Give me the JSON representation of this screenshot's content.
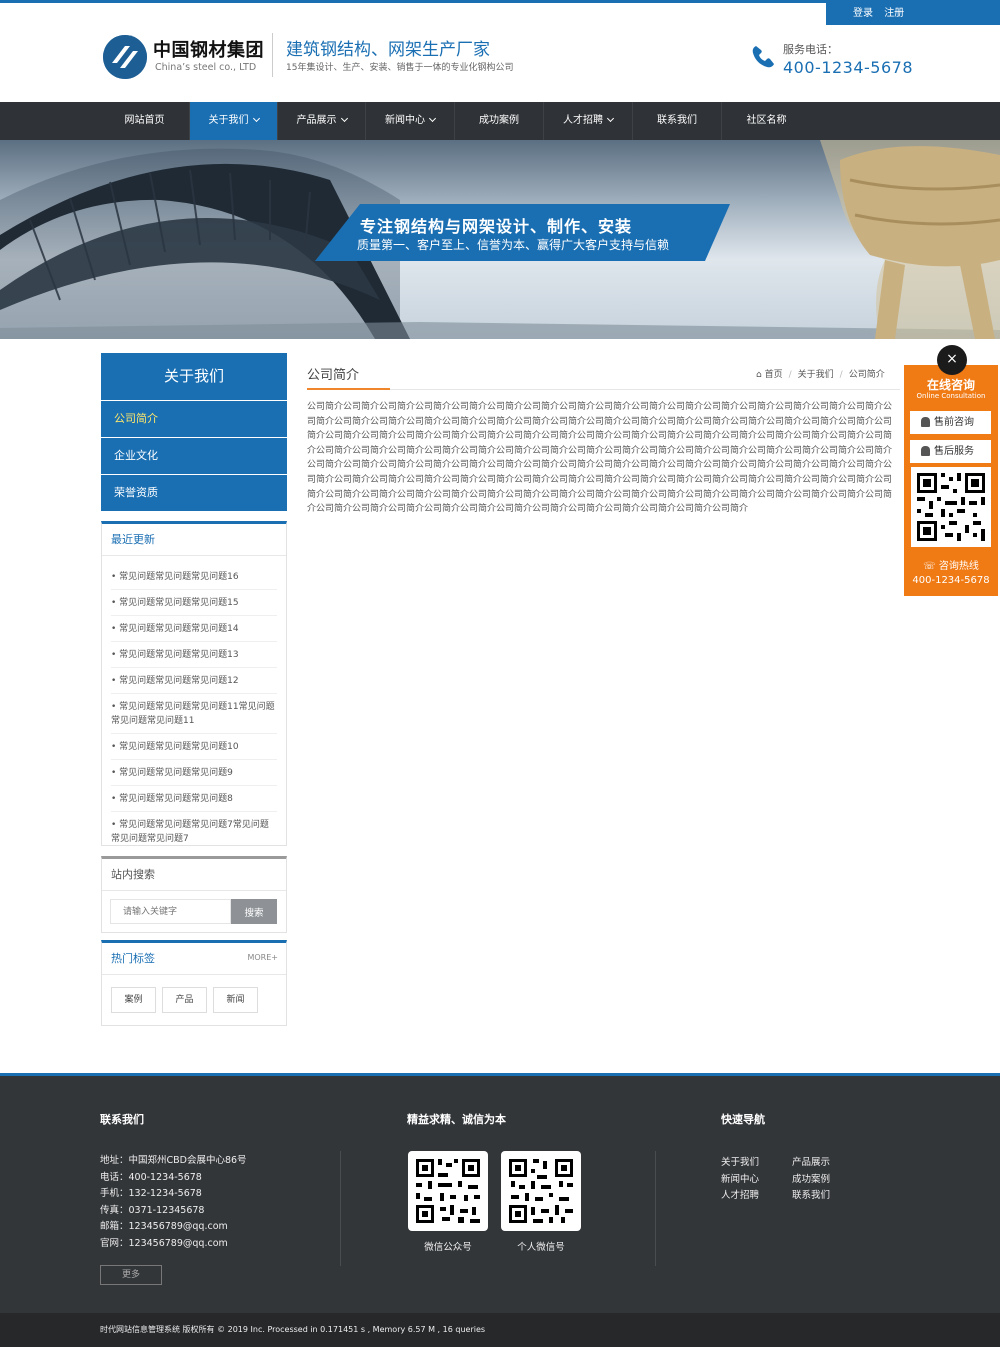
{
  "topbar": {
    "login": "登录",
    "register": "注册"
  },
  "header": {
    "logo_cn": "中国钢材集团",
    "logo_en": "China’s steel co., LTD",
    "slogan": "建筑钢结构、网架生产厂家",
    "slogan_sub": "15年集设计、生产、安装、销售于一体的专业化钢构公司",
    "service_label": "服务电话：",
    "service_number": "400-1234-5678"
  },
  "nav": {
    "items": [
      {
        "label": "网站首页"
      },
      {
        "label": "关于我们"
      },
      {
        "label": "产品展示"
      },
      {
        "label": "新闻中心"
      },
      {
        "label": "成功案例"
      },
      {
        "label": "人才招聘"
      },
      {
        "label": "联系我们"
      },
      {
        "label": "社区名称"
      }
    ]
  },
  "banner": {
    "title": "专注钢结构与网架设计、制作、安装",
    "subtitle": "质量第一、客户至上、信誉为本、赢得广大客户支持与信赖"
  },
  "sidebar": {
    "heading": "关于我们",
    "items": [
      {
        "label": "公司简介"
      },
      {
        "label": "企业文化"
      },
      {
        "label": "荣誉资质"
      }
    ]
  },
  "recent": {
    "title": "最近更新",
    "items": [
      "• 常见问题常见问题常见问题16",
      "• 常见问题常见问题常见问题15",
      "• 常见问题常见问题常见问题14",
      "• 常见问题常见问题常见问题13",
      "• 常见问题常见问题常见问题12",
      "• 常见问题常见问题常见问题11常见问题常见问题常见问题11",
      "• 常见问题常见问题常见问题10",
      "• 常见问题常见问题常见问题9",
      "• 常见问题常见问题常见问题8",
      "• 常见问题常见问题常见问题7常见问题常见问题常见问题7"
    ]
  },
  "search": {
    "title": "站内搜索",
    "placeholder": "请输入关键字",
    "button": "搜索"
  },
  "tags": {
    "title": "热门标签",
    "more": "MORE+",
    "items": [
      "案例",
      "产品",
      "新闻"
    ]
  },
  "content": {
    "title": "公司简介",
    "breadcrumb": {
      "home": "首页",
      "section": "关于我们",
      "current": "公司简介"
    },
    "body": "公司简介公司简介公司简介公司简介公司简介公司简介公司简介公司简介公司简介公司简介公司简介公司简介公司简介公司简介公司简介公司简介公司简介公司简介公司简介公司简介公司简介公司简介公司简介公司简介公司简介公司简介公司简介公司简介公司简介公司简介公司简介公司简介公司简介公司简介公司简介公司简介公司简介公司简介公司简介公司简介公司简介公司简介公司简介公司简介公司简介公司简介公司简介公司简介公司简介公司简介公司简介公司简介公司简介公司简介公司简介公司简介公司简介公司简介公司简介公司简介公司简介公司简介公司简介公司简介公司简介公司简介公司简介公司简介公司简介公司简介公司简介公司简介公司简介公司简介公司简介公司简介公司简介公司简介公司简介公司简介公司简介公司简介公司简介公司简介公司简介公司简介公司简介公司简介公司简介公司简介公司简介公司简介公司简介公司简介公司简介公司简介公司简介公司简介公司简介公司简介公司简介公司简介公司简介公司简介公司简介公司简介公司简介公司简介公司简介公司简介公司简介公司简介公司简介公司简介公司简介公司简介公司简介公司简介公司简介公司简介公司简介公司简介公司简介公司简介公司简介公司简介"
  },
  "float_panel": {
    "close": "×",
    "title": "在线咨询",
    "subtitle": "Online Consultation",
    "presale": "售前咨询",
    "aftersale": "售后服务",
    "hotline_label": "咨询热线",
    "hotline_number": "400-1234-5678"
  },
  "footer": {
    "contact": {
      "title": "联系我们",
      "lines": [
        "地址：中国郑州CBD会展中心86号",
        "电话：400-1234-5678",
        "手机：132-1234-5678",
        "传真：0371-12345678",
        "邮箱：123456789@qq.com",
        "官网：123456789@qq.com"
      ],
      "more": "更多"
    },
    "middle": {
      "title": "精益求精、诚信为本",
      "qr1_caption": "微信公众号",
      "qr2_caption": "个人微信号"
    },
    "quicknav": {
      "title": "快速导航",
      "items": [
        "关于我们",
        "产品展示",
        "新闻中心",
        "成功案例",
        "人才招聘",
        "联系我们"
      ]
    },
    "copyright": "时代网站信息管理系统   版权所有 © 2019 Inc.    Processed in 0.171451 s , Memory 6.57 M , 16 queries"
  },
  "colors": {
    "brand_blue": "#1a6fb3",
    "orange": "#f07a14",
    "dark": "#333639"
  }
}
